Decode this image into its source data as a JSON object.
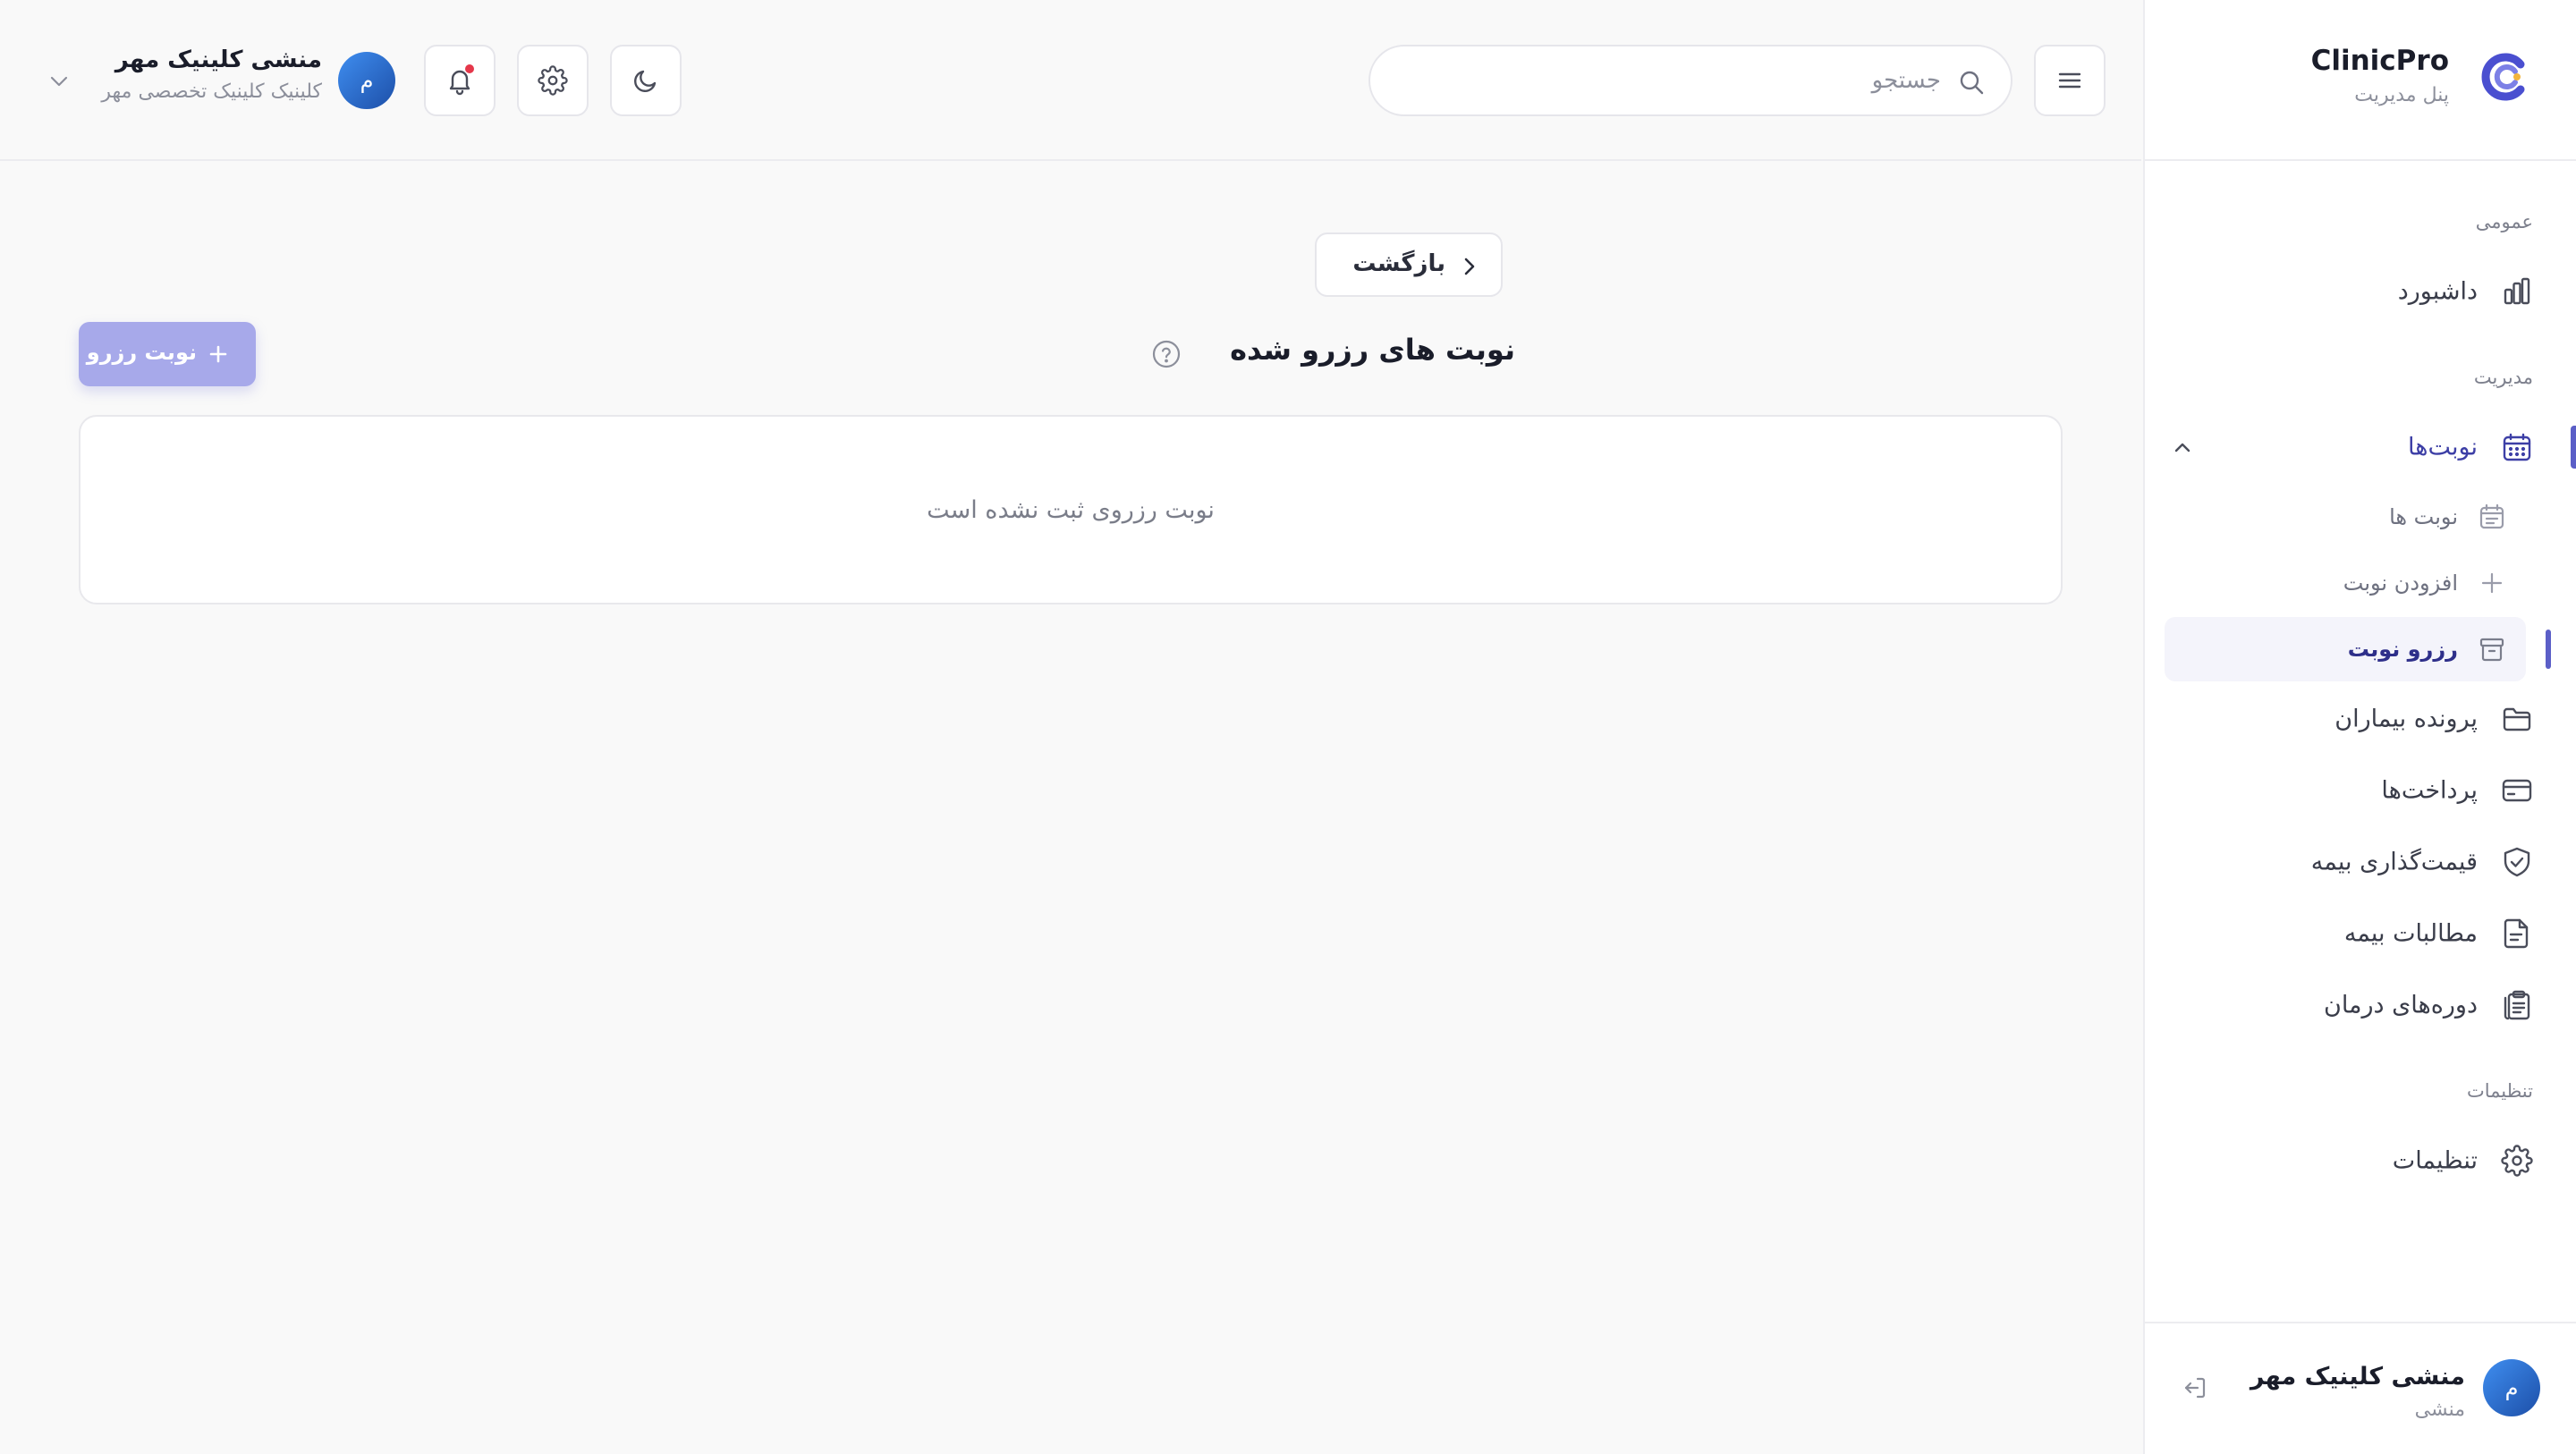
{
  "brand": {
    "name": "ClinicPro",
    "subtitle": "پنل مدیریت"
  },
  "sidebar": {
    "sections": {
      "general": "عمومی",
      "management": "مدیریت",
      "settings": "تنظیمات"
    },
    "items": {
      "dashboard": "داشبورد",
      "appointments": "نوبت‌ها",
      "patients": "پرونده بیماران",
      "payments": "پرداخت‌ها",
      "insurance_pricing": "قیمت‌گذاری بیمه",
      "insurance_claims": "مطالبات بیمه",
      "treatment_courses": "دوره‌های درمان",
      "settings": "تنظیمات"
    },
    "sub_items": {
      "appointments_list": "نوبت ها",
      "add_appointment": "افزودن نوبت",
      "reserve_appointment": "رزرو نوبت"
    },
    "user": {
      "avatar": "م",
      "name": "منشی کلینیک مهر",
      "role": "منشی"
    }
  },
  "topbar": {
    "search_placeholder": "جستجو",
    "user": {
      "avatar": "م",
      "name": "منشی کلینیک مهر",
      "subtitle": "کلینیک کلینیک تخصصی مهر"
    }
  },
  "main": {
    "back_label": "بازگشت",
    "title": "نوبت های رزرو شده",
    "add_button_label": "نوبت رزرو",
    "empty_message": "نوبت رزروی ثبت نشده است"
  },
  "colors": {
    "accent": "#5b5fc7",
    "accent_soft": "#a7a9ea",
    "notification": "#e5374a"
  }
}
